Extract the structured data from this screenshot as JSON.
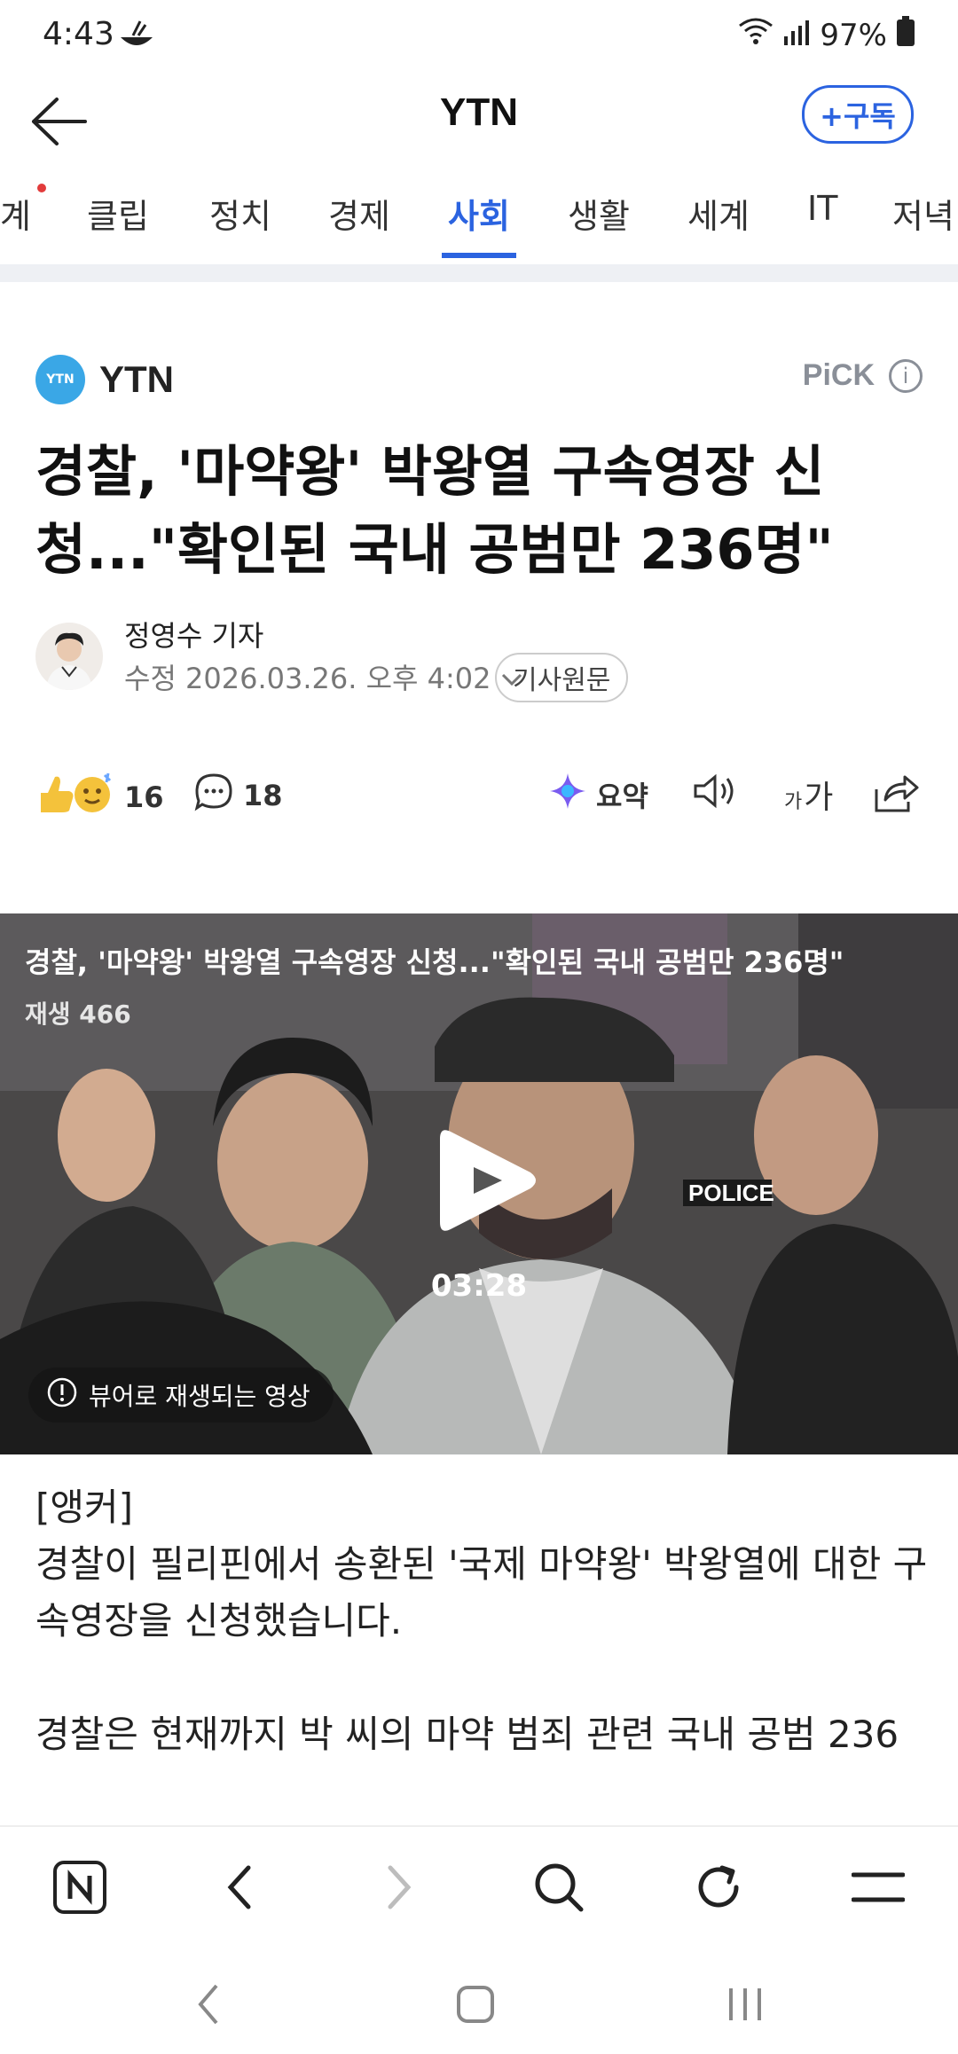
{
  "status_bar": {
    "time": "4:43",
    "battery": "97%"
  },
  "header": {
    "title": "YTN",
    "subscribe_label": "+구독"
  },
  "tabs": [
    {
      "label": "계",
      "active": false
    },
    {
      "label": "클립",
      "active": false
    },
    {
      "label": "정치",
      "active": false
    },
    {
      "label": "경제",
      "active": false
    },
    {
      "label": "사회",
      "active": true
    },
    {
      "label": "생활",
      "active": false
    },
    {
      "label": "세계",
      "active": false
    },
    {
      "label": "IT",
      "active": false
    },
    {
      "label": "저녁",
      "active": false
    }
  ],
  "press": {
    "name": "YTN",
    "logo_text": "YTN",
    "pick_label": "PiCK"
  },
  "article": {
    "headline_line1": "경찰, '마약왕' 박왕열 구속영장 신",
    "headline_line2": "청...\"확인된 국내 공범만 236명\"",
    "reporter": "정영수 기자",
    "modified": "수정 2026.03.26. 오후 4:02",
    "source_button": "기사원문"
  },
  "actions": {
    "reactions_count": "16",
    "comments_count": "18",
    "summary_label": "요약",
    "font_size_label_small": "가",
    "font_size_label_large": "가"
  },
  "video": {
    "title": "경찰, '마약왕' 박왕열 구속영장 신청...\"확인된 국내 공범만 236명\"",
    "views": "재생 466",
    "duration": "03:28",
    "viewer_notice": "뷰어로 재생되는 영상",
    "badge_text": "POLICE"
  },
  "body": {
    "anchor_tag": "[앵커]",
    "para1": "경찰이 필리핀에서 송환된 '국제 마약왕' 박왕열에 대한 구속영장을 신청했습니다.",
    "para2": "경찰은 현재까지 박 씨의 마약 범죄 관련 국내 공범 236"
  },
  "colors": {
    "accent": "#2b63e0",
    "notification_dot": "#e23b3b"
  }
}
